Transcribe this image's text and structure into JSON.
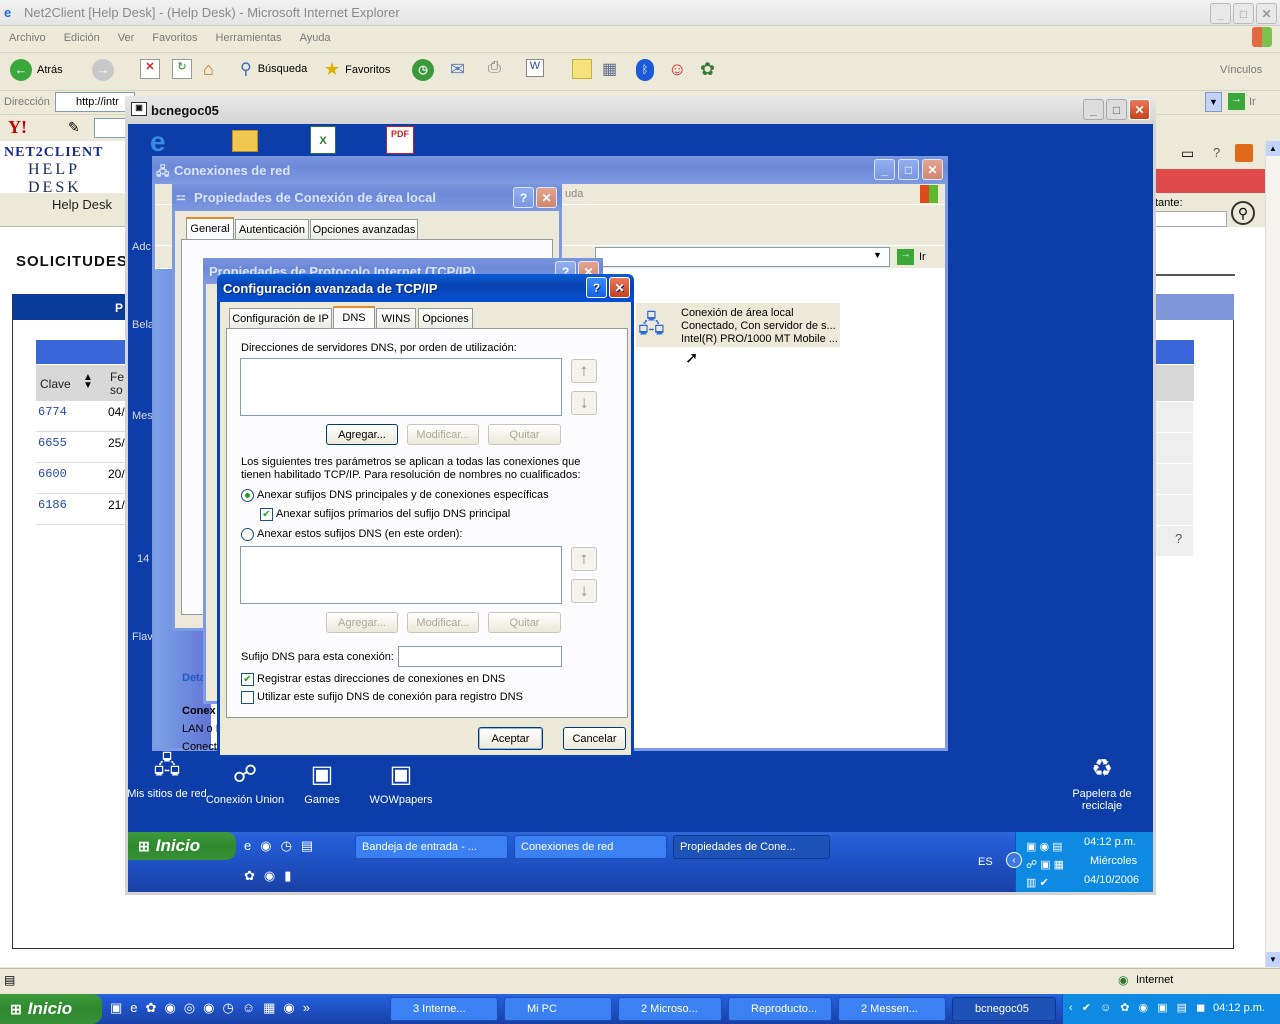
{
  "ie": {
    "title": "Net2Client [Help Desk] - (Help Desk) - Microsoft Internet Explorer",
    "menu": [
      "Archivo",
      "Edición",
      "Ver",
      "Favoritos",
      "Herramientas",
      "Ayuda"
    ],
    "back": "Atrás",
    "search": "Búsqueda",
    "favorites": "Favoritos",
    "links": "Vínculos",
    "address_label": "Dirección",
    "address": "http://intr",
    "go": "Ir",
    "status_zone": "Internet"
  },
  "helpdesk": {
    "logo_top": "NET2CLIENT",
    "logo_sub": "HELP DESK",
    "nav_label": "Help Desk",
    "section": "SOLICITUDES",
    "search_label": "tante:",
    "col_clave": "Clave",
    "col_fecha": "Fe so",
    "rows": [
      {
        "id": "6774",
        "date": "04/"
      },
      {
        "id": "6655",
        "date": "25/"
      },
      {
        "id": "6600",
        "date": "20/"
      },
      {
        "id": "6186",
        "date": "21/"
      }
    ]
  },
  "remote": {
    "title": "bcnegoc05",
    "desktop_icons": [
      {
        "label": "Mis sitios de red"
      },
      {
        "label": "Conexión Union"
      },
      {
        "label": "Games"
      },
      {
        "label": "WOWpapers"
      },
      {
        "label": "Papelera de reciclaje"
      }
    ],
    "side_labels": [
      "Adc",
      "Bela",
      "Mes",
      "14",
      "Flav"
    ],
    "start": "Inicio",
    "tasks": [
      "Bandeja de entrada - ...",
      "Conexiones de red",
      "Propiedades de Cone..."
    ],
    "lang": "ES",
    "clock": {
      "time": "04:12 p.m.",
      "day": "Miércoles",
      "date": "04/10/2006"
    }
  },
  "netconn": {
    "title": "Conexiones de red",
    "help_hint": "uda",
    "go": "Ir",
    "item_name": "Conexión de área local",
    "item_status": "Conectado, Con servidor de s...",
    "item_device": "Intel(R) PRO/1000 MT Mobile ...",
    "details_label": "Deta",
    "conn_label": "Conex",
    "lan_label": "LAN o I",
    "conecta": "Conect"
  },
  "lanprops": {
    "title": "Propiedades de Conexión de área local",
    "tabs": [
      "General",
      "Autenticación",
      "Opciones avanzadas"
    ]
  },
  "tcpip": {
    "title": "Propiedades de Protocolo Internet (TCP/IP)"
  },
  "adv": {
    "title": "Configuración avanzada de TCP/IP",
    "tabs": [
      "Configuración de IP",
      "DNS",
      "WINS",
      "Opciones"
    ],
    "dns_list_label": "Direcciones de servidores DNS, por orden de utilización:",
    "add": "Agregar...",
    "modify": "Modificar...",
    "remove": "Quitar",
    "params_text_1": "Los siguientes tres parámetros se aplican a todas las conexiones que",
    "params_text_2": "tienen habilitado TCP/IP. Para resolución de nombres no cualificados:",
    "radio1": "Anexar sufijos DNS principales y de conexiones específicas",
    "check1": "Anexar sufijos primarios del sufijo DNS principal",
    "radio2": "Anexar estos sufijos DNS (en este orden):",
    "suffix_label": "Sufijo DNS para esta conexión:",
    "suffix_value": "",
    "check2": "Registrar estas direcciones de conexiones en DNS",
    "check3": "Utilizar este sufijo DNS de conexión para registro DNS",
    "ok": "Aceptar",
    "cancel": "Cancelar"
  },
  "host_taskbar": {
    "start": "Inicio",
    "tasks": [
      "3 Interne...",
      "Mi PC",
      "2 Microso...",
      "Reproducto...",
      "2 Messen...",
      "bcnegoc05"
    ],
    "time": "04:12 p.m."
  }
}
